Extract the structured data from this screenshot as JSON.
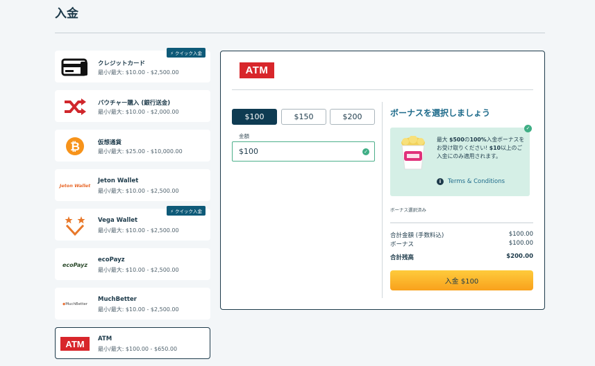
{
  "page": {
    "title": "入金"
  },
  "methods": [
    {
      "name": "クレジットカード",
      "limits": "最小/最大: $10.00 - $2,500.00",
      "badge": "クイック入金",
      "icon": "credit-card-icon"
    },
    {
      "name": "バウチャー購入 (銀行送金)",
      "limits": "最小/最大: $10.00 - $2,000.00",
      "icon": "shuffle-icon"
    },
    {
      "name": "仮想通貨",
      "limits": "最小/最大: $25.00 - $10,000.00",
      "icon": "bitcoin-icon"
    },
    {
      "name": "Jeton Wallet",
      "limits": "最小/最大: $10.00 - $2,500.00",
      "logo_text": "Jeton Wallet"
    },
    {
      "name": "Vega Wallet",
      "limits": "最小/最大: $10.00 - $2,500.00",
      "badge": "クイック入金",
      "icon": "vega-logo-icon"
    },
    {
      "name": "ecoPayz",
      "limits": "最小/最大: $10.00 - $2,500.00",
      "logo_text": "ecoPayz"
    },
    {
      "name": "MuchBetter",
      "limits": "最小/最大: $10.00 - $2,500.00",
      "logo_text": "MuchBetter"
    },
    {
      "name": "ATM",
      "limits": "最小/最大: $100.00 - $650.00",
      "logo_text": "ATM",
      "selected": true
    }
  ],
  "panel": {
    "logo_text": "ATM",
    "amount_options": [
      "$100",
      "$150",
      "$200"
    ],
    "selected_amount": "$100",
    "amount_label": "金額",
    "amount_value": "$100",
    "bonus": {
      "title": "ボーナスを選択しましょう",
      "text_1": "最大 ",
      "text_2": "$500",
      "text_3": "の",
      "text_4": "100%",
      "text_5": "入金ボーナスをお受け取りください! ",
      "text_6": "$10",
      "text_7": "以上のご入金にのみ適用されます。",
      "terms": "Terms & Conditions",
      "selected_text": "ボーナス選択済み"
    },
    "summary": [
      {
        "label": "合計金額 (手数料込)",
        "value": "$100.00"
      },
      {
        "label": "ボーナス",
        "value": "$100.00"
      },
      {
        "label": "合計残高",
        "value": "$200.00"
      }
    ],
    "deposit_label": "入金 $100"
  },
  "colors": {
    "accent": "#0e3b52",
    "brand_red": "#d8262b",
    "button": "#fbb82a",
    "bonus_bg": "#d5efe6"
  }
}
